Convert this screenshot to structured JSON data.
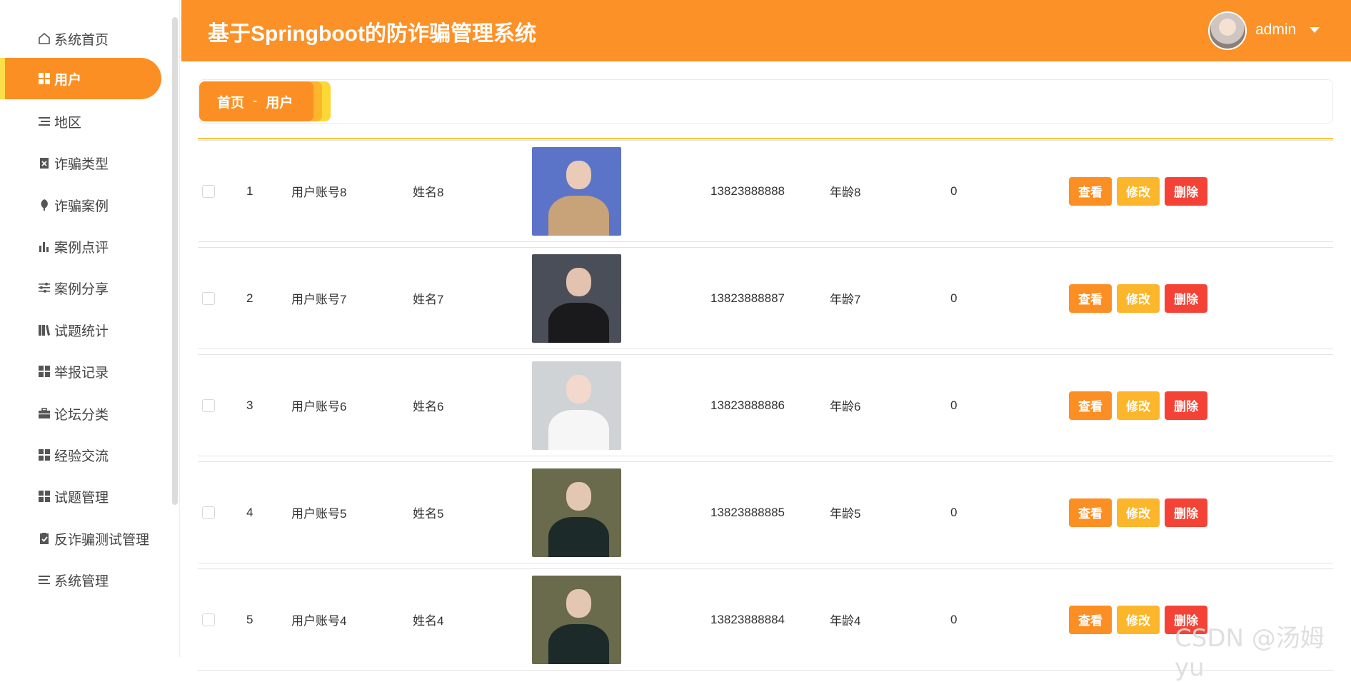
{
  "header": {
    "title": "基于Springboot的防诈骗管理系统",
    "username": "admin"
  },
  "sidebar": {
    "items": [
      {
        "label": "系统首页",
        "icon": "home-icon"
      },
      {
        "label": "用户",
        "icon": "grid-icon"
      },
      {
        "label": "地区",
        "icon": "list-icon"
      },
      {
        "label": "诈骗类型",
        "icon": "clipboard-x-icon"
      },
      {
        "label": "诈骗案例",
        "icon": "leaf-icon"
      },
      {
        "label": "案例点评",
        "icon": "bar-chart-icon"
      },
      {
        "label": "案例分享",
        "icon": "sliders-icon"
      },
      {
        "label": "试题统计",
        "icon": "books-icon"
      },
      {
        "label": "举报记录",
        "icon": "grid-icon"
      },
      {
        "label": "论坛分类",
        "icon": "briefcase-icon"
      },
      {
        "label": "经验交流",
        "icon": "grid-icon"
      },
      {
        "label": "试题管理",
        "icon": "grid-icon"
      },
      {
        "label": "反诈骗测试管理",
        "icon": "clipboard-check-icon"
      },
      {
        "label": "系统管理",
        "icon": "list-icon"
      }
    ],
    "active": "用户"
  },
  "breadcrumb": {
    "home": "首页",
    "separator": "-",
    "current": "用户"
  },
  "table": {
    "rows": [
      {
        "index": "1",
        "account": "用户账号8",
        "name": "姓名8",
        "phone": "13823888888",
        "age": "年龄8",
        "count": "0"
      },
      {
        "index": "2",
        "account": "用户账号7",
        "name": "姓名7",
        "phone": "13823888887",
        "age": "年龄7",
        "count": "0"
      },
      {
        "index": "3",
        "account": "用户账号6",
        "name": "姓名6",
        "phone": "13823888886",
        "age": "年龄6",
        "count": "0"
      },
      {
        "index": "4",
        "account": "用户账号5",
        "name": "姓名5",
        "phone": "13823888885",
        "age": "年龄5",
        "count": "0"
      },
      {
        "index": "5",
        "account": "用户账号4",
        "name": "姓名4",
        "phone": "13823888884",
        "age": "年龄4",
        "count": "0"
      }
    ],
    "actions": {
      "view": "查看",
      "edit": "修改",
      "delete": "删除"
    }
  },
  "watermark": "CSDN @汤姆yu",
  "colors": {
    "primary": "#fb8f24",
    "secondary": "#fbb62b",
    "danger": "#f44336",
    "accent": "#fde047"
  }
}
